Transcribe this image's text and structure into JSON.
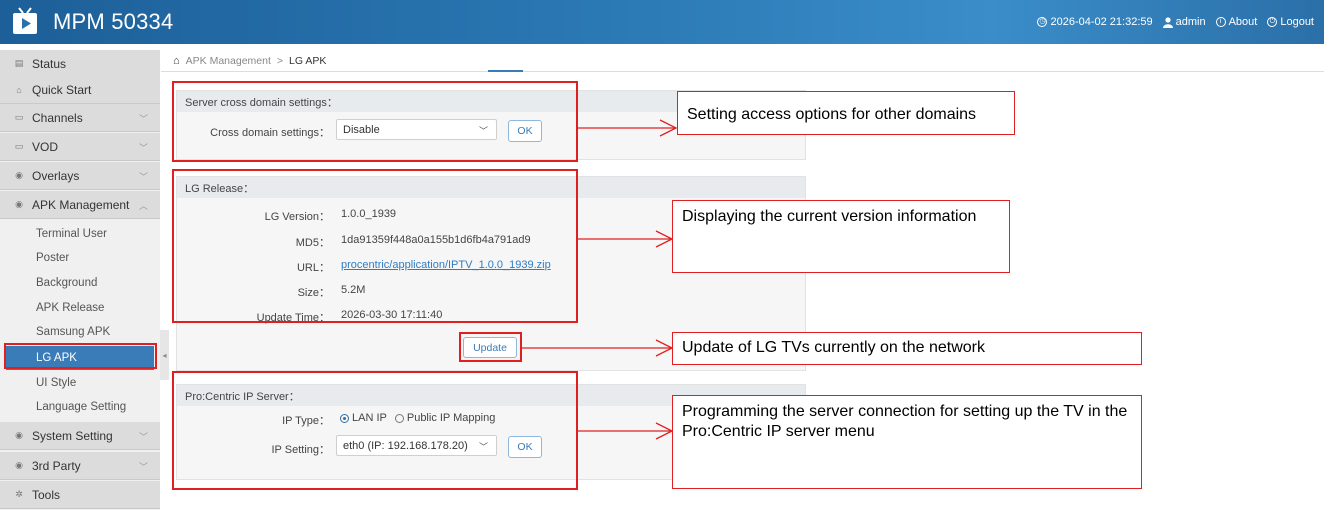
{
  "header": {
    "title": "MPM 50334",
    "datetime": "2026-04-02 21:32:59",
    "user": "admin",
    "about": "About",
    "logout": "Logout"
  },
  "sidebar": {
    "items": [
      {
        "label": "Status",
        "icon": "status-icon"
      },
      {
        "label": "Quick Start",
        "icon": "quick-start-icon"
      },
      {
        "label": "Channels",
        "icon": "monitor-icon"
      },
      {
        "label": "VOD",
        "icon": "monitor-icon"
      },
      {
        "label": "Overlays",
        "icon": "dot-icon"
      },
      {
        "label": "APK Management",
        "icon": "dot-icon"
      },
      {
        "label": "System Setting",
        "icon": "dot-icon"
      },
      {
        "label": "3rd Party",
        "icon": "dot-icon"
      },
      {
        "label": "Tools",
        "icon": "tools-icon"
      }
    ],
    "subitems": [
      "Terminal User",
      "Poster",
      "Background",
      "APK Release",
      "Samsung APK",
      "LG APK",
      "UI Style",
      "Language Setting"
    ]
  },
  "breadcrumb": {
    "parent": "APK Management",
    "separator": ">",
    "current": "LG APK"
  },
  "cross_domain": {
    "heading": "Server cross domain settings：",
    "label": "Cross domain settings：",
    "value": "Disable",
    "ok": "OK"
  },
  "lg_release": {
    "heading": "LG Release：",
    "fields": [
      {
        "label": "LG Version：",
        "value": "1.0.0_1939"
      },
      {
        "label": "MD5：",
        "value": "1da91359f448a0a155b1d6fb4a791ad9"
      },
      {
        "label": "URL：",
        "value": "procentric/application/IPTV_1.0.0_1939.zip"
      },
      {
        "label": "Size：",
        "value": "5.2M"
      },
      {
        "label": "Update Time：",
        "value": "2026-03-30 17:11:40"
      }
    ],
    "update_button": "Update"
  },
  "procentric": {
    "heading": "Pro:Centric IP Server：",
    "ip_type_label": "IP Type：",
    "ip_type_options": [
      "LAN IP",
      "Public IP Mapping"
    ],
    "ip_type_selected": "LAN IP",
    "ip_setting_label": "IP Setting：",
    "ip_setting_value": "eth0 (IP: 192.168.178.20)",
    "ok": "OK"
  },
  "annotations": [
    "Setting access options for other domains",
    "Displaying the current version information",
    "Update of LG TVs currently on the network",
    "Programming the server connection for setting up the TV in the Pro:Centric IP server menu"
  ],
  "colors": {
    "header": "#2a78b4",
    "accent": "#3a7cb8",
    "annotation": "#e02020"
  }
}
